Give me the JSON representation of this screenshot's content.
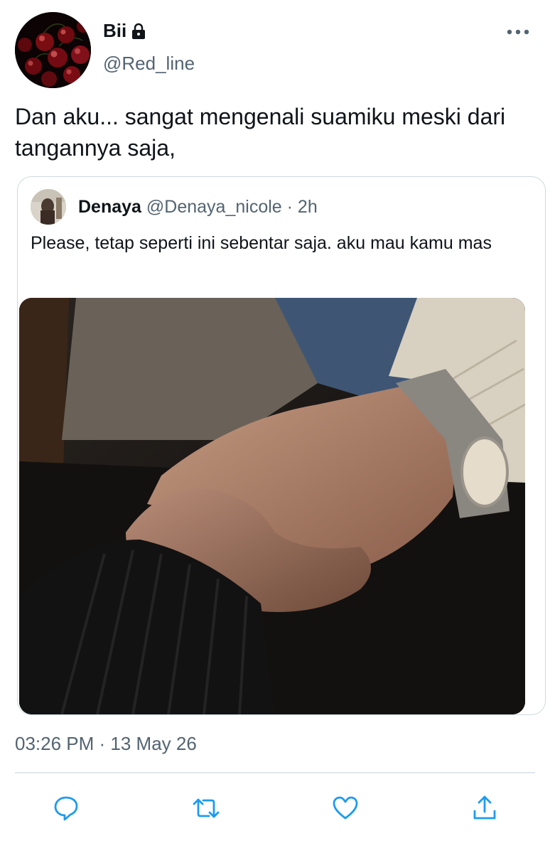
{
  "author": {
    "display_name": "Bii",
    "handle": "@Red_line",
    "avatar_icon": "cherries-avatar",
    "protected_icon": "lock-icon"
  },
  "tweet": {
    "text": "Dan aku... sangat mengenali suamiku meski dari tangannya saja,",
    "timestamp": "03:26 PM · 13 May 26"
  },
  "quoted_tweet": {
    "display_name": "Denaya",
    "handle": "@Denaya_nicole",
    "time_ago": "· 2h",
    "text": "Please, tetap seperti ini sebentar saja. aku mau kamu mas",
    "media_description_icon": "photo-holding-hands"
  },
  "actions": {
    "reply_icon": "reply-icon",
    "retweet_icon": "retweet-icon",
    "like_icon": "heart-icon",
    "share_icon": "share-icon"
  },
  "colors": {
    "text_primary": "#0f1419",
    "text_secondary": "#536471",
    "border": "#cfd9de",
    "icon": "#1d9bf0"
  }
}
